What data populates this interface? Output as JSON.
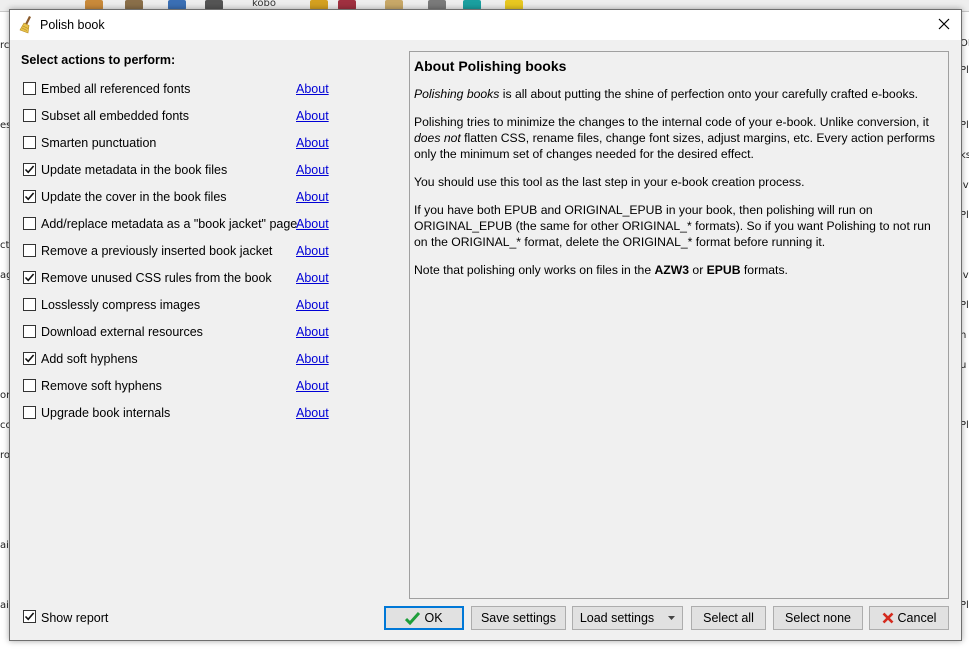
{
  "dialog": {
    "title": "Polish book",
    "section_label": "Select actions to perform:",
    "about_label": "About",
    "actions": [
      {
        "label": "Embed all referenced fonts",
        "checked": false
      },
      {
        "label": "Subset all embedded fonts",
        "checked": false
      },
      {
        "label": "Smarten punctuation",
        "checked": false
      },
      {
        "label": "Update metadata in the book files",
        "checked": true
      },
      {
        "label": "Update the cover in the book files",
        "checked": true
      },
      {
        "label": "Add/replace metadata as a \"book jacket\" page",
        "checked": false
      },
      {
        "label": "Remove a previously inserted book jacket",
        "checked": false
      },
      {
        "label": "Remove unused CSS rules from the book",
        "checked": true
      },
      {
        "label": "Losslessly compress images",
        "checked": false
      },
      {
        "label": "Download external resources",
        "checked": false
      },
      {
        "label": "Add soft hyphens",
        "checked": true
      },
      {
        "label": "Remove soft hyphens",
        "checked": false
      },
      {
        "label": "Upgrade book internals",
        "checked": false
      }
    ],
    "show_report": {
      "label": "Show report",
      "checked": true
    },
    "buttons": {
      "ok": "OK",
      "save_settings": "Save settings",
      "load_settings": "Load settings",
      "select_all": "Select all",
      "select_none": "Select none",
      "cancel": "Cancel"
    }
  },
  "help": {
    "heading": "About Polishing books",
    "p1_em": "Polishing books",
    "p1_rest": " is all about putting the shine of perfection onto your carefully crafted e-books.",
    "p2_a": "Polishing tries to minimize the changes to the internal code of your e-book. Unlike conversion, it ",
    "p2_em": "does not",
    "p2_b": " flatten CSS, rename files, change font sizes, adjust margins, etc. Every action performs only the minimum set of changes needed for the desired effect.",
    "p3": "You should use this tool as the last step in your e-book creation process.",
    "p4": "If you have both EPUB and ORIGINAL_EPUB in your book, then polishing will run on ORIGINAL_EPUB (the same for other ORIGINAL_* formats). So if you want Polishing to not run on the ORIGINAL_* format, delete the ORIGINAL_* format before running it.",
    "p5_a": "Note that polishing only works on files in the ",
    "p5_b1": "AZW3",
    "p5_mid": " or ",
    "p5_b2": "EPUB",
    "p5_c": " formats."
  },
  "background": {
    "left_fragments": [
      "rc",
      "es",
      "ct",
      "ag",
      "or",
      "co",
      "ro",
      "ain",
      "ain"
    ],
    "right_fragments": [
      "OR",
      "Pl",
      "Pl",
      "ks",
      "iv",
      "Pl",
      "iv",
      "Pl",
      "n",
      "u",
      "Pl",
      "Pl"
    ],
    "toolbar_text": "kobo"
  },
  "colors": {
    "dialog_bg": "#f0f0f0",
    "link": "#0000d6",
    "ok_check": "#1e9e3a",
    "cancel_x": "#d42a1e",
    "default_button_border": "#0078d7"
  }
}
